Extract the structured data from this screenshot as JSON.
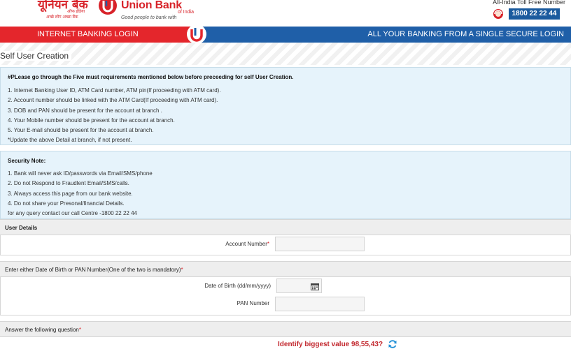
{
  "header": {
    "logo_hindi": "यूनियन बैंक",
    "logo_hindi_sub": "ऑफ इंडिया",
    "logo_hindi_tag": "अच्छे लोग अच्छा बैंक",
    "logo_en": "Union Bank",
    "logo_en_sub": "of India",
    "logo_tag": "Good people to bank with",
    "toll_label": "All-India Toll Free Number",
    "toll_number": "1800 22 22 44"
  },
  "banner": {
    "left_text": "INTERNET BANKING LOGIN",
    "right_text": "ALL YOUR BANKING FROM A SINGLE SECURE LOGIN"
  },
  "page_title": "Self User Creation",
  "requirements": {
    "heading": "#PLease go through the Five must requirements mentioned below before preceeding for self User Creation.",
    "items": [
      "1. Internet Banking User ID, ATM Card number, ATM pin(If proceeding with ATM card).",
      "2. Account number should be linked with the ATM Card(If proceeding with ATM card).",
      "3. DOB and PAN should be present for the account at branch .",
      "4. Your Mobile number should be present for the account at branch.",
      "5. Your E-mail should be present for the account at branch.",
      "*Update the above Detail at branch, if not present."
    ]
  },
  "security": {
    "heading": "Security Note:",
    "items": [
      "1. Bank will never ask ID/passwords via Email/SMS/phone",
      "2. Do not Respond to Fraudlent Email/SMS/calls.",
      "3. Always access this page from our bank website.",
      "4. Do not share your Presonal/financial Details.",
      "for any query contact our call Centre -1800 22 22 44"
    ]
  },
  "user_details": {
    "heading": "User Details",
    "account_label": "Account Number",
    "account_value": ""
  },
  "dob_pan": {
    "heading": "Enter either Date of Birth or PAN Number(One of the two is mandatory)",
    "dob_label": "Date of Birth (dd/mm/yyyy)",
    "dob_value": "",
    "pan_label": "PAN Number",
    "pan_value": ""
  },
  "question": {
    "heading": "Answer the following question",
    "captcha_text": "Identify biggest value 98,55,43?"
  },
  "required_mark": "*",
  "colors": {
    "brand_red": "#e4262c",
    "brand_blue": "#1f5fa8",
    "info_bg": "#e6f3fb"
  }
}
